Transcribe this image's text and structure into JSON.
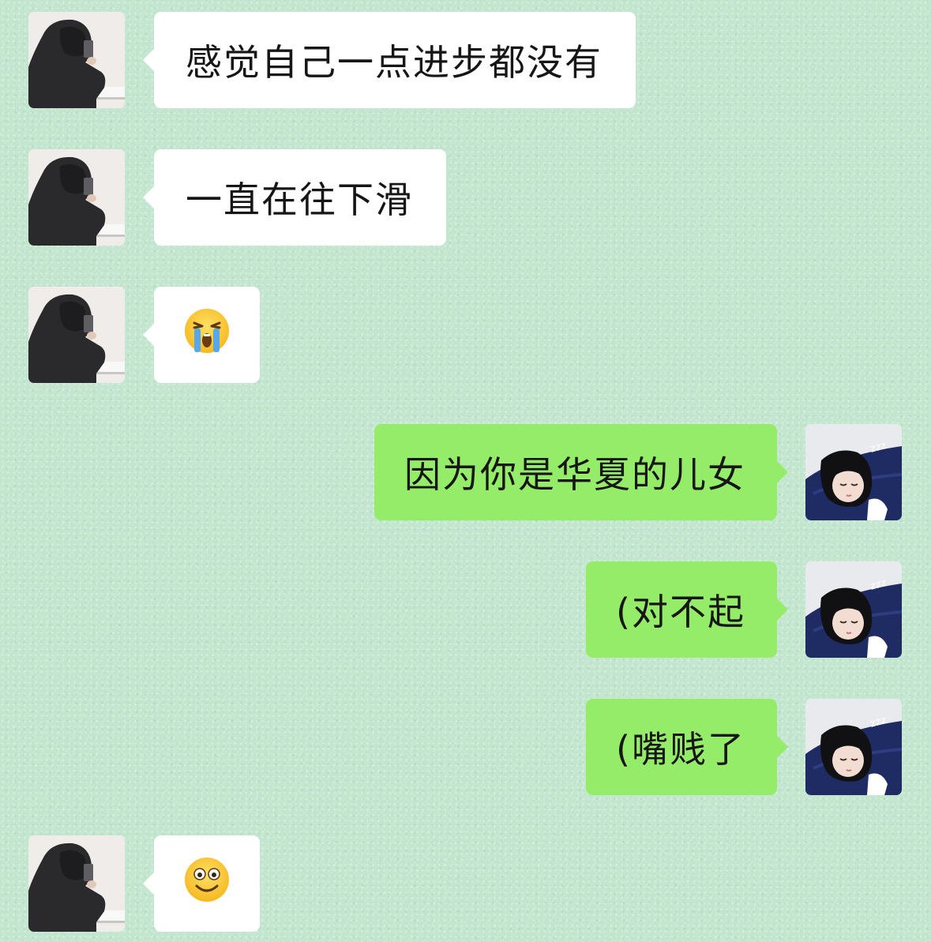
{
  "chat": {
    "background_color": "#c3e6cf",
    "incoming_bubble_color": "#ffffff",
    "outgoing_bubble_color": "#95ec69",
    "messages": [
      {
        "side": "incoming",
        "type": "text",
        "text": "感觉自己一点进步都没有"
      },
      {
        "side": "incoming",
        "type": "text",
        "text": "一直在往下滑"
      },
      {
        "side": "incoming",
        "type": "emoji",
        "emoji": "loudly-crying-face-icon"
      },
      {
        "side": "outgoing",
        "type": "text",
        "text": "因为你是华夏的儿女"
      },
      {
        "side": "outgoing",
        "type": "text",
        "text": "(对不起"
      },
      {
        "side": "outgoing",
        "type": "text",
        "text": "(嘴贱了"
      },
      {
        "side": "incoming",
        "type": "emoji",
        "emoji": "smiling-face-icon"
      }
    ],
    "avatars": {
      "incoming": "hooded-person-avatar",
      "outgoing": "sleeping-girl-avatar"
    },
    "sleep_mark": "zzz"
  }
}
